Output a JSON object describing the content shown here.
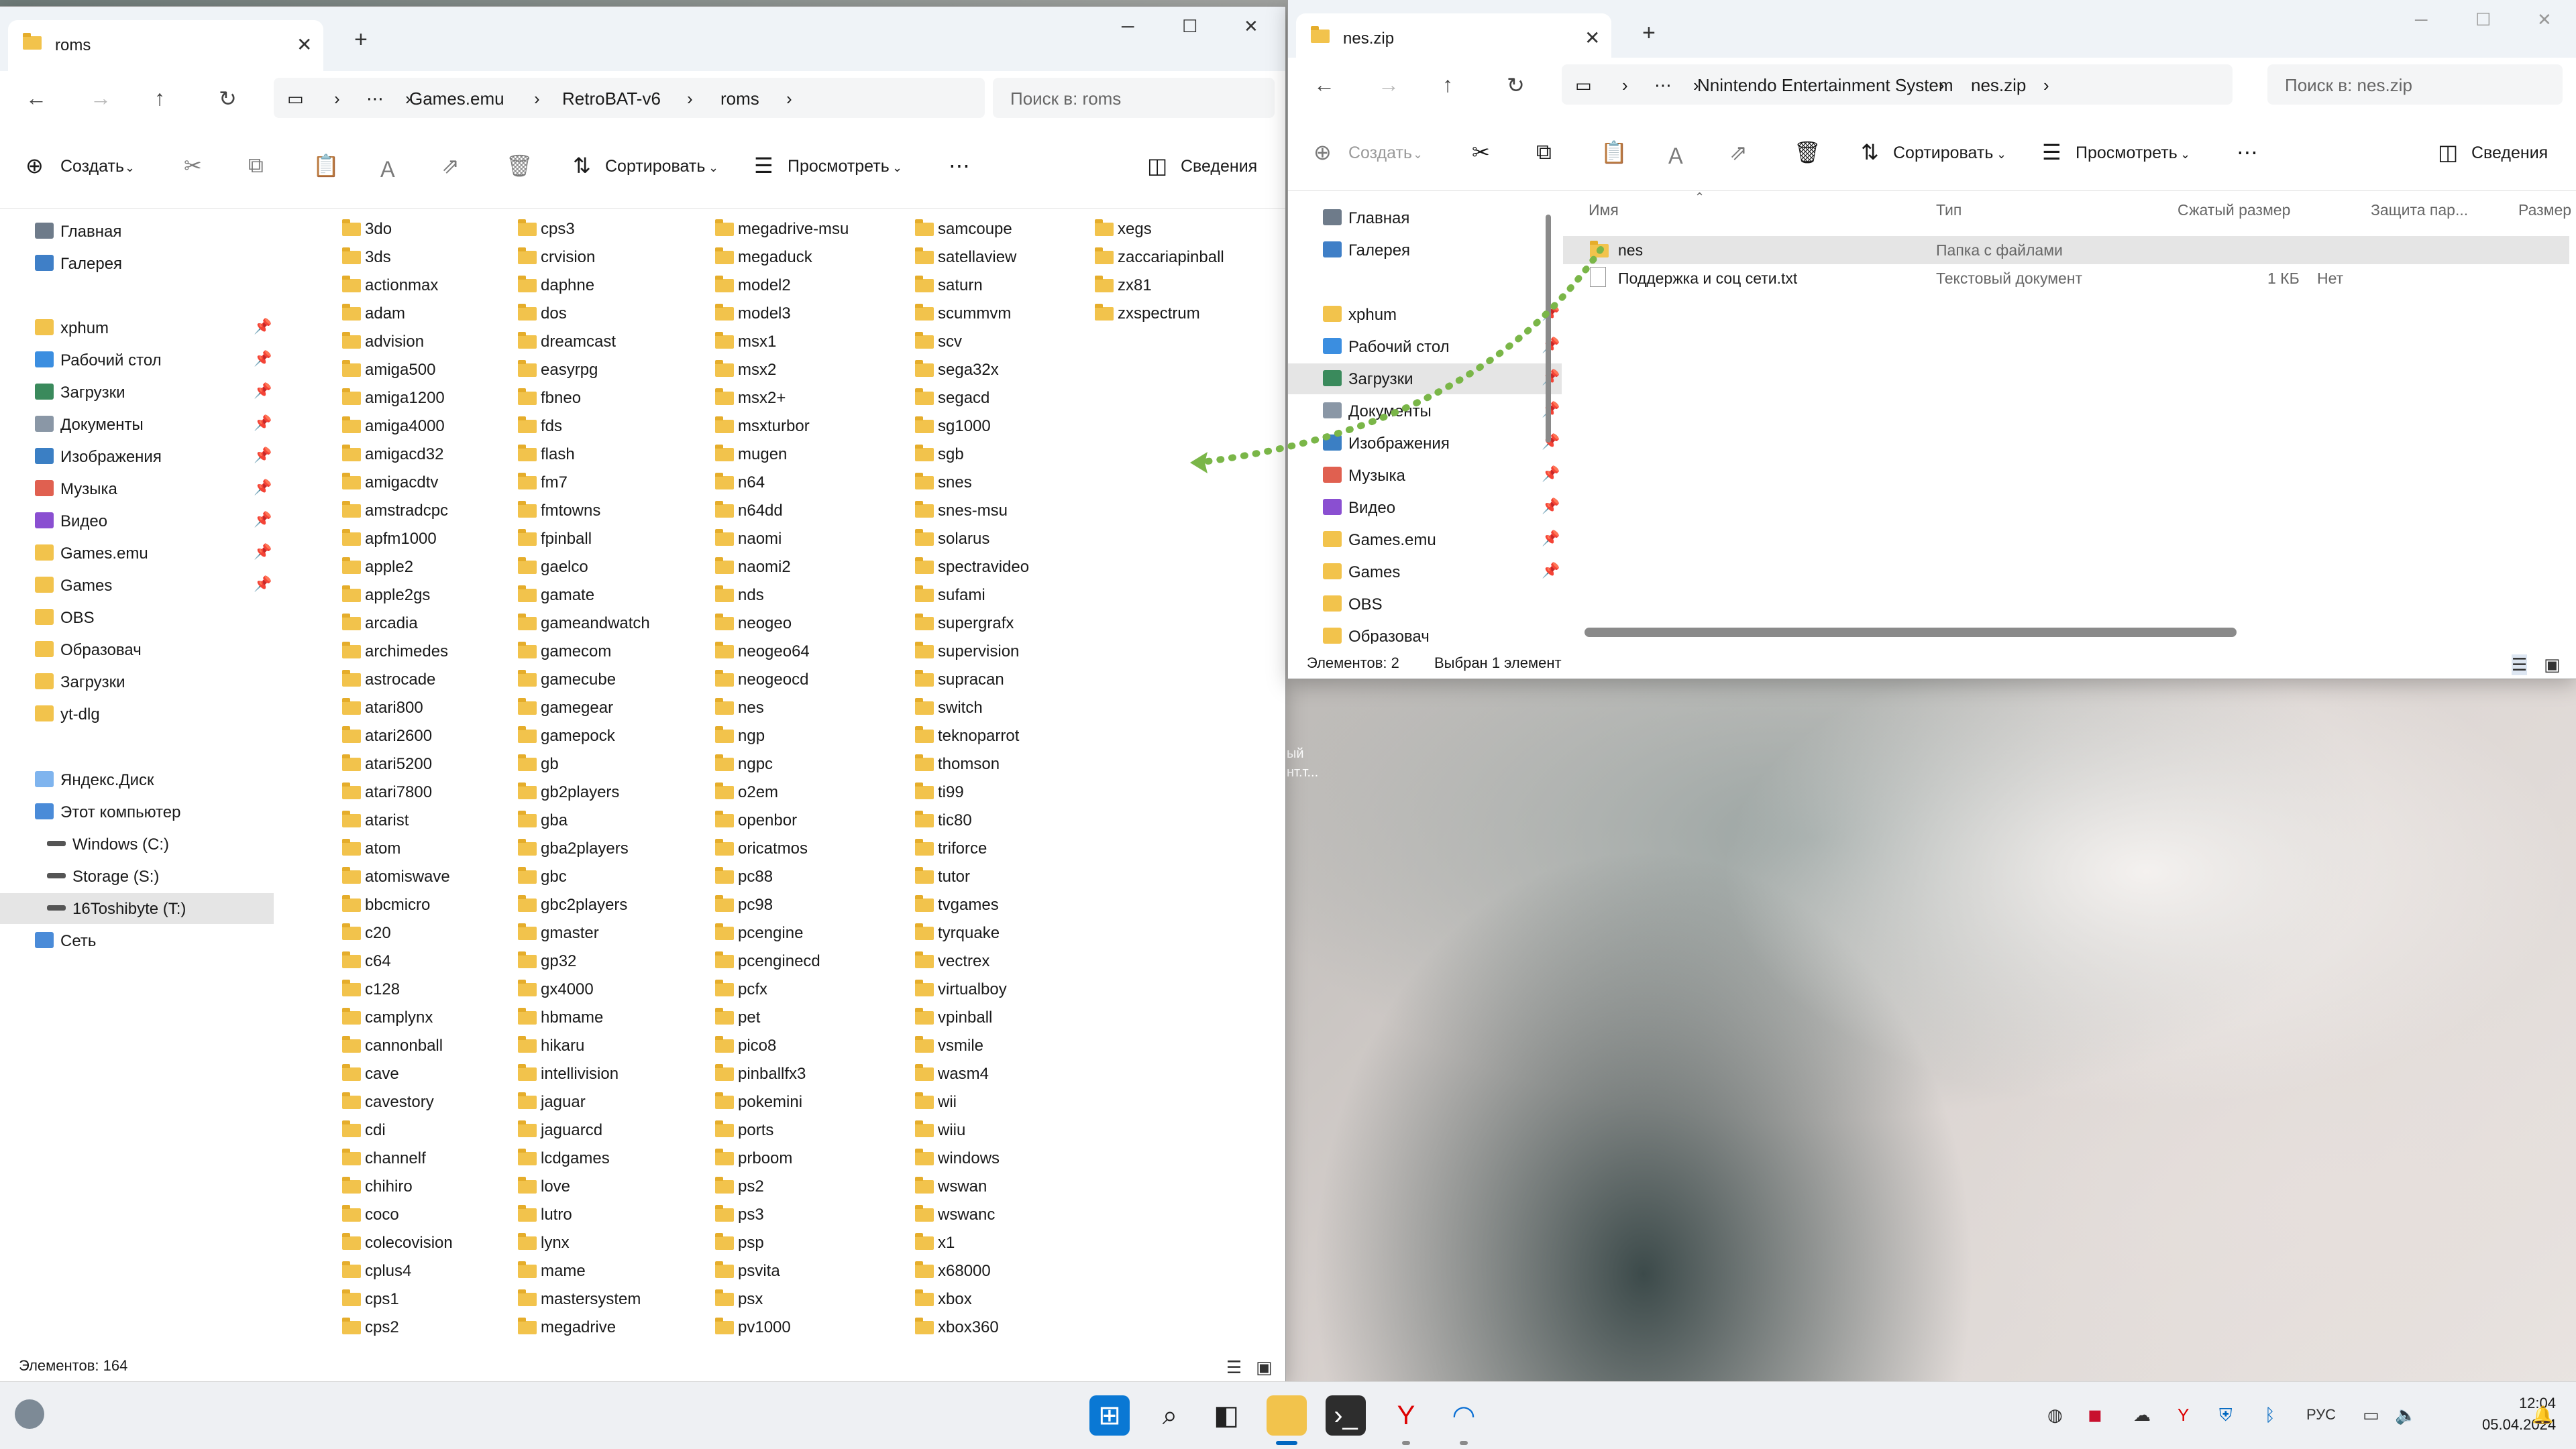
{
  "left_window": {
    "tab_title": "roms",
    "breadcrumb": [
      "Games.emu",
      "RetroBAT-v6",
      "roms"
    ],
    "search_placeholder": "Поиск в: roms",
    "cmd": {
      "create": "Создать",
      "sort": "Сортировать",
      "view": "Просмотреть",
      "details": "Сведения"
    },
    "sidebar": [
      {
        "label": "Главная",
        "icon": "home-icon",
        "pinned": false
      },
      {
        "label": "Галерея",
        "icon": "gallery-icon",
        "pinned": false
      },
      {
        "label": "xphum",
        "icon": "folder-icon",
        "pinned": true
      },
      {
        "label": "Рабочий стол",
        "icon": "desktop-icon",
        "pinned": true
      },
      {
        "label": "Загрузки",
        "icon": "download-icon",
        "pinned": true
      },
      {
        "label": "Документы",
        "icon": "documents-icon",
        "pinned": true
      },
      {
        "label": "Изображения",
        "icon": "pictures-icon",
        "pinned": true
      },
      {
        "label": "Музыка",
        "icon": "music-icon",
        "pinned": true
      },
      {
        "label": "Видео",
        "icon": "video-icon",
        "pinned": true
      },
      {
        "label": "Games.emu",
        "icon": "folder-icon",
        "pinned": true
      },
      {
        "label": "Games",
        "icon": "folder-icon",
        "pinned": true
      },
      {
        "label": "OBS",
        "icon": "folder-icon",
        "pinned": false
      },
      {
        "label": "Образовач",
        "icon": "folder-icon",
        "pinned": false
      },
      {
        "label": "Загрузки",
        "icon": "folder-synced-icon",
        "pinned": false
      },
      {
        "label": "yt-dlg",
        "icon": "folder-icon",
        "pinned": false
      },
      {
        "label": "Яндекс.Диск",
        "icon": "yandex-disk-icon",
        "pinned": false
      },
      {
        "label": "Этот компьютер",
        "icon": "computer-icon",
        "pinned": false
      },
      {
        "label": "Windows (C:)",
        "icon": "drive-icon",
        "pinned": false
      },
      {
        "label": "Storage (S:)",
        "icon": "drive-icon",
        "pinned": false
      },
      {
        "label": "16Toshibyte (T:)",
        "icon": "drive-icon",
        "pinned": false
      },
      {
        "label": "Сеть",
        "icon": "network-icon",
        "pinned": false
      }
    ],
    "folders": [
      [
        "3do",
        "3ds",
        "actionmax",
        "adam",
        "advision",
        "amiga500",
        "amiga1200",
        "amiga4000",
        "amigacd32",
        "amigacdtv",
        "amstradcpc",
        "apfm1000",
        "apple2",
        "apple2gs",
        "arcadia",
        "archimedes",
        "astrocade",
        "atari800",
        "atari2600",
        "atari5200",
        "atari7800",
        "atarist",
        "atom",
        "atomiswave",
        "bbcmicro",
        "c20",
        "c64",
        "c128",
        "camplynx",
        "cannonball",
        "cave",
        "cavestory",
        "cdi",
        "channelf",
        "chihiro",
        "coco",
        "colecovision",
        "cplus4",
        "cps1",
        "cps2"
      ],
      [
        "cps3",
        "crvision",
        "daphne",
        "dos",
        "dreamcast",
        "easyrpg",
        "fbneo",
        "fds",
        "flash",
        "fm7",
        "fmtowns",
        "fpinball",
        "gaelco",
        "gamate",
        "gameandwatch",
        "gamecom",
        "gamecube",
        "gamegear",
        "gamepock",
        "gb",
        "gb2players",
        "gba",
        "gba2players",
        "gbc",
        "gbc2players",
        "gmaster",
        "gp32",
        "gx4000",
        "hbmame",
        "hikaru",
        "intellivision",
        "jaguar",
        "jaguarcd",
        "lcdgames",
        "love",
        "lutro",
        "lynx",
        "mame",
        "mastersystem",
        "megadrive"
      ],
      [
        "megadrive-msu",
        "megaduck",
        "model2",
        "model3",
        "msx1",
        "msx2",
        "msx2+",
        "msxturbor",
        "mugen",
        "n64",
        "n64dd",
        "naomi",
        "naomi2",
        "nds",
        "neogeo",
        "neogeo64",
        "neogeocd",
        "nes",
        "ngp",
        "ngpc",
        "o2em",
        "openbor",
        "oricatmos",
        "pc88",
        "pc98",
        "pcengine",
        "pcenginecd",
        "pcfx",
        "pet",
        "pico8",
        "pinballfx3",
        "pokemini",
        "ports",
        "prboom",
        "ps2",
        "ps3",
        "psp",
        "psvita",
        "psx",
        "pv1000"
      ],
      [
        "samcoupe",
        "satellaview",
        "saturn",
        "scummvm",
        "scv",
        "sega32x",
        "segacd",
        "sg1000",
        "sgb",
        "snes",
        "snes-msu",
        "solarus",
        "spectravideo",
        "sufami",
        "supergrafx",
        "supervision",
        "supracan",
        "switch",
        "teknoparrot",
        "thomson",
        "ti99",
        "tic80",
        "triforce",
        "tutor",
        "tvgames",
        "tyrquake",
        "vectrex",
        "virtualboy",
        "vpinball",
        "vsmile",
        "wasm4",
        "wii",
        "wiiu",
        "windows",
        "wswan",
        "wswanc",
        "x1",
        "x68000",
        "xbox",
        "xbox360"
      ],
      [
        "xegs",
        "zaccariapinball",
        "zx81",
        "zxspectrum"
      ]
    ],
    "status": "Элементов: 164"
  },
  "right_window": {
    "tab_title": "nes.zip",
    "breadcrumb": [
      "Nnintendo Entertainment System",
      "nes.zip"
    ],
    "search_placeholder": "Поиск в: nes.zip",
    "cmd": {
      "create": "Создать",
      "sort": "Сортировать",
      "view": "Просмотреть",
      "details": "Сведения"
    },
    "sidebar": [
      {
        "label": "Главная",
        "icon": "home-icon",
        "pinned": false
      },
      {
        "label": "Галерея",
        "icon": "gallery-icon",
        "pinned": false
      },
      {
        "label": "xphum",
        "icon": "folder-icon",
        "pinned": true
      },
      {
        "label": "Рабочий стол",
        "icon": "desktop-icon",
        "pinned": true
      },
      {
        "label": "Загрузки",
        "icon": "download-icon",
        "pinned": true
      },
      {
        "label": "Документы",
        "icon": "documents-icon",
        "pinned": true
      },
      {
        "label": "Изображения",
        "icon": "pictures-icon",
        "pinned": true
      },
      {
        "label": "Музыка",
        "icon": "music-icon",
        "pinned": true
      },
      {
        "label": "Видео",
        "icon": "video-icon",
        "pinned": true
      },
      {
        "label": "Games.emu",
        "icon": "folder-icon",
        "pinned": true
      },
      {
        "label": "Games",
        "icon": "folder-icon",
        "pinned": true
      },
      {
        "label": "OBS",
        "icon": "folder-icon",
        "pinned": false
      },
      {
        "label": "Образовач",
        "icon": "folder-icon",
        "pinned": false
      }
    ],
    "columns": [
      "Имя",
      "Тип",
      "Сжатый размер",
      "Защита пар...",
      "Размер"
    ],
    "rows": [
      {
        "name": "nes",
        "type": "Папка с файлами",
        "compressed": "",
        "protected": "",
        "size": ""
      },
      {
        "name": "Поддержка и соц сети.txt",
        "type": "Текстовый документ",
        "compressed": "1 КБ",
        "protected": "Нет",
        "size": ""
      }
    ],
    "status_count": "Элементов: 2",
    "status_selected": "Выбран 1 элемент"
  },
  "desktop": {
    "icon_label_line1": "ый",
    "icon_label_line2": "нт.т..."
  },
  "taskbar": {
    "lang": "РУС",
    "time": "12:04",
    "date": "05.04.2024",
    "apps": [
      "start-icon",
      "search-icon",
      "task-view-icon",
      "file-explorer-icon",
      "terminal-icon",
      "yandex-browser-icon",
      "edge-icon"
    ]
  },
  "colors": {
    "accent": "#0067c0",
    "folder": "#f2c34c",
    "drag": "#7ab648"
  }
}
